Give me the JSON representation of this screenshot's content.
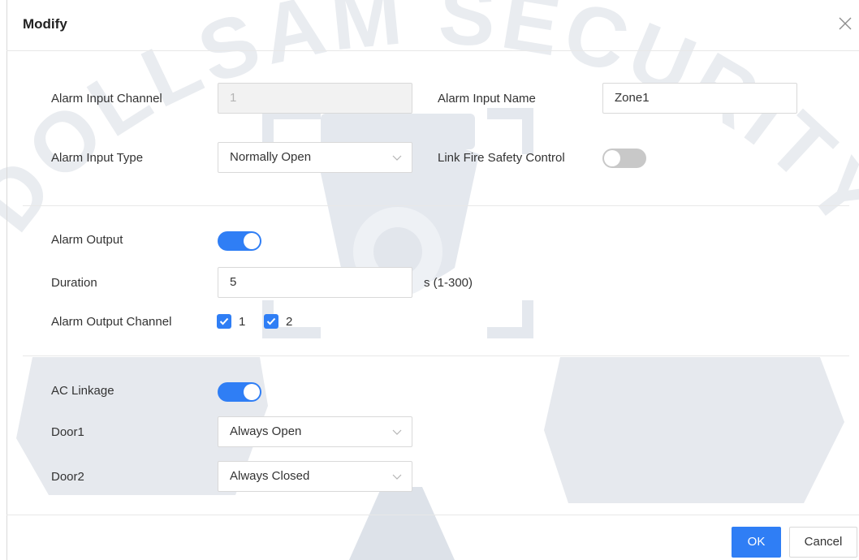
{
  "dialog": {
    "title": "Modify"
  },
  "alarm_input": {
    "channel_label": "Alarm Input Channel",
    "channel_value": "1",
    "name_label": "Alarm Input Name",
    "name_value": "Zone1",
    "type_label": "Alarm Input Type",
    "type_value": "Normally Open",
    "fire_label": "Link Fire Safety Control",
    "fire_enabled": false
  },
  "alarm_output": {
    "label": "Alarm Output",
    "enabled": true,
    "duration_label": "Duration",
    "duration_value": "5",
    "duration_unit": "s (1-300)",
    "channel_label": "Alarm Output Channel",
    "channels": [
      {
        "label": "1",
        "checked": true
      },
      {
        "label": "2",
        "checked": true
      }
    ]
  },
  "ac_linkage": {
    "label": "AC Linkage",
    "enabled": true,
    "door1_label": "Door1",
    "door1_value": "Always Open",
    "door2_label": "Door2",
    "door2_value": "Always Closed"
  },
  "footer": {
    "ok_label": "OK",
    "cancel_label": "Cancel"
  },
  "watermark": {
    "text": "DOLLSAM SECURITY"
  },
  "colors": {
    "accent": "#2f7ef5",
    "toggle_off": "#c8c8c8",
    "disabled_bg": "#f2f2f2",
    "watermark": "#e9ecf0"
  }
}
